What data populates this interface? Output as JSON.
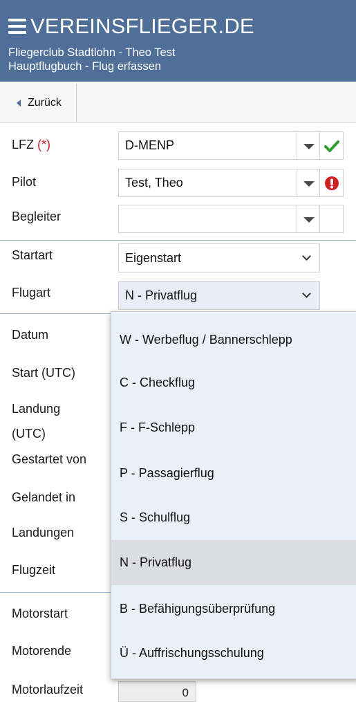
{
  "header": {
    "brand": "VEREINSFLIEGER.DE",
    "line1": "Fliegerclub Stadtlohn - Theo Test",
    "line2": "Hauptflugbuch - Flug erfassen"
  },
  "toolbar": {
    "back_label": "Zurück"
  },
  "form": {
    "lfz_label": "LFZ",
    "required_marker": "(*)",
    "lfz_value": "D-MENP",
    "pilot_label": "Pilot",
    "pilot_value": "Test, Theo",
    "begleiter_label": "Begleiter",
    "begleiter_value": "",
    "startart_label": "Startart",
    "startart_value": "Eigenstart",
    "flugart_label": "Flugart",
    "flugart_value": "N - Privatflug",
    "datum_label": "Datum",
    "start_label": "Start (UTC)",
    "landung_label_1": "Landung",
    "landung_label_2": "(UTC)",
    "gestartet_label": "Gestartet von",
    "gelandet_label": "Gelandet in",
    "landungen_label": "Landungen",
    "flugzeit_label": "Flugzeit",
    "motorstart_label": "Motorstart",
    "motorende_label": "Motorende",
    "motorlaufzeit_label": "Motorlaufzeit",
    "motorlaufzeit_value": "0"
  },
  "dropdown": {
    "options": [
      "W - Werbeflug / Bannerschlepp",
      "C - Checkflug",
      "F - F-Schlepp",
      "P - Passagierflug",
      "S - Schulflug",
      "N - Privatflug",
      "B - Befähigungsüberprüfung",
      "Ü - Auffrischungsschulung"
    ],
    "selected": "N - Privatflug"
  },
  "colors": {
    "header_bg": "#4f6f98",
    "ok": "#2e9e2e",
    "error": "#cc1f1f",
    "menu_bg": "#eaf0f8"
  },
  "icons": {
    "menu": "hamburger-icon",
    "back": "caret-left-icon",
    "lfz_status": "check-icon",
    "pilot_status": "error-icon"
  }
}
